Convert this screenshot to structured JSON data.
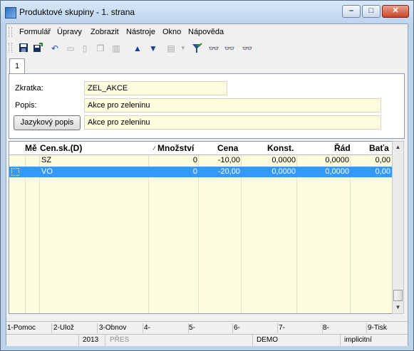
{
  "window": {
    "title": "Produktové skupiny - 1. strana"
  },
  "menu": [
    "Formulář",
    "Úpravy",
    "Zobrazit",
    "Nástroje",
    "Okno",
    "Nápověda"
  ],
  "toolbar": {
    "icons": [
      "save-icon",
      "save-close-icon",
      "undo-icon",
      "open-folder-icon",
      "new-document-icon",
      "copy-icon",
      "book-icon",
      "arrow-up-icon",
      "arrow-down-icon",
      "print-icon",
      "dropdown-icon",
      "filter-icon",
      "binoculars-icon",
      "binoculars-next-icon",
      "binoculars-all-icon"
    ]
  },
  "tab": {
    "label": "1"
  },
  "form": {
    "zkratka_label": "Zkratka:",
    "zkratka_value": "ZEL_AKCE",
    "popis_label": "Popis:",
    "popis_value": "Akce pro zeleninu",
    "jazykovy_button": "Jazykový popis",
    "jazykovy_value": "Akce pro zeleninu"
  },
  "grid": {
    "headers": [
      "Mě",
      "Cen.sk.(D)",
      "Množství",
      "Cena",
      "Konst.",
      "Řád",
      "Baťa"
    ],
    "rows": [
      [
        "",
        "SZ",
        "0",
        "-10,00",
        "0,0000",
        "0,0000",
        "0,00"
      ],
      [
        "",
        "VO",
        "0",
        "-20,00",
        "0,0000",
        "0,0000",
        "0,00"
      ]
    ],
    "selected_row": 1
  },
  "fkeys": [
    "1-Pomoc",
    "2-Ulož",
    "3-Obnov",
    "4-",
    "5-",
    "6-",
    "7-",
    "8-",
    "9-Tisk"
  ],
  "status": {
    "year": "2013",
    "mode": "PŘES",
    "company": "DEMO",
    "setting": "implicitní"
  }
}
